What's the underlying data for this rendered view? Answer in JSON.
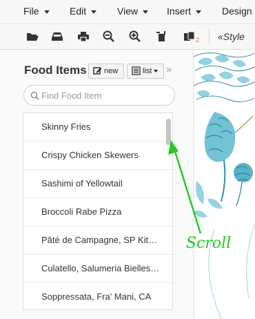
{
  "menubar": {
    "items": [
      {
        "label": "File"
      },
      {
        "label": "Edit"
      },
      {
        "label": "View"
      },
      {
        "label": "Insert"
      },
      {
        "label": "Design"
      }
    ]
  },
  "toolbar": {
    "icons": [
      "folder-open-icon",
      "inbox-tray-icon",
      "print-icon",
      "zoom-out-icon",
      "zoom-in-icon",
      "bring-forward-icon",
      "layers-badge-icon"
    ],
    "badge": "2",
    "style_label": "«Style"
  },
  "panel": {
    "title": "Food Items",
    "new_label": "new",
    "list_label": "list",
    "collapse_glyph": "»",
    "search_placeholder": "Find Food Item",
    "items": [
      "Skinny Fries",
      "Crispy Chicken Skewers",
      "Sashimi of Yellowtail",
      "Broccoli Rabe Pizza",
      "Pâté de Campagne, SP Kit…",
      "Culatello, Salumeria Bielles…",
      "Soppressata, Fra' Mani, CA"
    ]
  },
  "annotation": {
    "text": "Scroll",
    "color": "#22cc22"
  },
  "colors": {
    "artichoke": "#5bb8cc",
    "artichoke_dark": "#2f8fa6"
  }
}
